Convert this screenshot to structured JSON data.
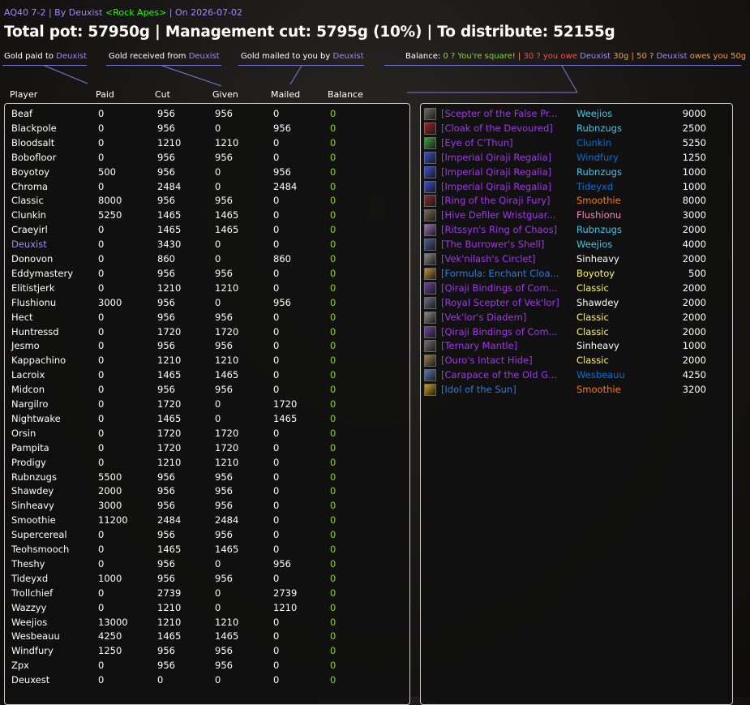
{
  "header": {
    "raid": "AQ40 7-2",
    "by_text": " | By ",
    "author": "Deuxist",
    "guild": "<Rock Apes>",
    "date_text": " | On 2026-07-02",
    "pot_line": "Total pot: 57950g | Management cut: 5795g (10%) | To distribute: 52155g"
  },
  "legend": {
    "paid_label": "Gold paid to ",
    "received_label": "Gold received from ",
    "mailed_label": "Gold mailed to you by ",
    "author": "Deuxist",
    "balance_label": "Balance: ",
    "square_text": "0 ? You're square!",
    "sep": " | ",
    "owe_text": "30 ? you owe ",
    "owe_amount": " 30g",
    "owed_text": "50 ? ",
    "owed_tail": " owes you 50g"
  },
  "columns": [
    "Player",
    "Paid",
    "Cut",
    "Given",
    "Mailed",
    "Balance"
  ],
  "colors": {
    "self_name": "#9a8cff",
    "balance_green": "#8bd52a",
    "epic": "#a335ee",
    "rare": "#2f7bdc",
    "class_mage": "#40c7eb",
    "class_paladin": "#f58cba",
    "class_shaman": "#0070dd",
    "class_priest": "#ffffff",
    "class_druid": "#ff7d0a",
    "class_rogue": "#fff569"
  },
  "players": [
    {
      "name": "Beaf",
      "paid": "0",
      "cut": "956",
      "given": "956",
      "mailed": "0",
      "balance": "0"
    },
    {
      "name": "Blackpole",
      "paid": "0",
      "cut": "956",
      "given": "0",
      "mailed": "956",
      "balance": "0"
    },
    {
      "name": "Bloodsalt",
      "paid": "0",
      "cut": "1210",
      "given": "1210",
      "mailed": "0",
      "balance": "0"
    },
    {
      "name": "Bobofloor",
      "paid": "0",
      "cut": "956",
      "given": "956",
      "mailed": "0",
      "balance": "0"
    },
    {
      "name": "Boyotoy",
      "paid": "500",
      "cut": "956",
      "given": "0",
      "mailed": "956",
      "balance": "0"
    },
    {
      "name": "Chroma",
      "paid": "0",
      "cut": "2484",
      "given": "0",
      "mailed": "2484",
      "balance": "0"
    },
    {
      "name": "Classic",
      "paid": "8000",
      "cut": "956",
      "given": "956",
      "mailed": "0",
      "balance": "0"
    },
    {
      "name": "Clunkin",
      "paid": "5250",
      "cut": "1465",
      "given": "1465",
      "mailed": "0",
      "balance": "0"
    },
    {
      "name": "Craeyirl",
      "paid": "0",
      "cut": "1465",
      "given": "1465",
      "mailed": "0",
      "balance": "0"
    },
    {
      "name": "Deuxist",
      "paid": "0",
      "cut": "3430",
      "given": "0",
      "mailed": "0",
      "balance": "0",
      "self": true
    },
    {
      "name": "Donovon",
      "paid": "0",
      "cut": "860",
      "given": "0",
      "mailed": "860",
      "balance": "0"
    },
    {
      "name": "Eddymastery",
      "paid": "0",
      "cut": "956",
      "given": "956",
      "mailed": "0",
      "balance": "0"
    },
    {
      "name": "Elitistjerk",
      "paid": "0",
      "cut": "1210",
      "given": "1210",
      "mailed": "0",
      "balance": "0"
    },
    {
      "name": "Flushionu",
      "paid": "3000",
      "cut": "956",
      "given": "0",
      "mailed": "956",
      "balance": "0"
    },
    {
      "name": "Hect",
      "paid": "0",
      "cut": "956",
      "given": "956",
      "mailed": "0",
      "balance": "0"
    },
    {
      "name": "Huntressd",
      "paid": "0",
      "cut": "1720",
      "given": "1720",
      "mailed": "0",
      "balance": "0"
    },
    {
      "name": "Jesmo",
      "paid": "0",
      "cut": "956",
      "given": "956",
      "mailed": "0",
      "balance": "0"
    },
    {
      "name": "Kappachino",
      "paid": "0",
      "cut": "1210",
      "given": "1210",
      "mailed": "0",
      "balance": "0"
    },
    {
      "name": "Lacroix",
      "paid": "0",
      "cut": "1465",
      "given": "1465",
      "mailed": "0",
      "balance": "0"
    },
    {
      "name": "Midcon",
      "paid": "0",
      "cut": "956",
      "given": "956",
      "mailed": "0",
      "balance": "0"
    },
    {
      "name": "Nargilro",
      "paid": "0",
      "cut": "1720",
      "given": "0",
      "mailed": "1720",
      "balance": "0"
    },
    {
      "name": "Nightwake",
      "paid": "0",
      "cut": "1465",
      "given": "0",
      "mailed": "1465",
      "balance": "0"
    },
    {
      "name": "Orsin",
      "paid": "0",
      "cut": "1720",
      "given": "1720",
      "mailed": "0",
      "balance": "0"
    },
    {
      "name": "Pampita",
      "paid": "0",
      "cut": "1720",
      "given": "1720",
      "mailed": "0",
      "balance": "0"
    },
    {
      "name": "Prodigy",
      "paid": "0",
      "cut": "1210",
      "given": "1210",
      "mailed": "0",
      "balance": "0"
    },
    {
      "name": "Rubnzugs",
      "paid": "5500",
      "cut": "956",
      "given": "956",
      "mailed": "0",
      "balance": "0"
    },
    {
      "name": "Shawdey",
      "paid": "2000",
      "cut": "956",
      "given": "956",
      "mailed": "0",
      "balance": "0"
    },
    {
      "name": "Sinheavy",
      "paid": "3000",
      "cut": "956",
      "given": "956",
      "mailed": "0",
      "balance": "0"
    },
    {
      "name": "Smoothie",
      "paid": "11200",
      "cut": "2484",
      "given": "2484",
      "mailed": "0",
      "balance": "0"
    },
    {
      "name": "Supercereal",
      "paid": "0",
      "cut": "956",
      "given": "956",
      "mailed": "0",
      "balance": "0"
    },
    {
      "name": "Teohsmooch",
      "paid": "0",
      "cut": "1465",
      "given": "1465",
      "mailed": "0",
      "balance": "0"
    },
    {
      "name": "Theshy",
      "paid": "0",
      "cut": "956",
      "given": "0",
      "mailed": "956",
      "balance": "0"
    },
    {
      "name": "Tideyxd",
      "paid": "1000",
      "cut": "956",
      "given": "956",
      "mailed": "0",
      "balance": "0"
    },
    {
      "name": "Trollchief",
      "paid": "0",
      "cut": "2739",
      "given": "0",
      "mailed": "2739",
      "balance": "0"
    },
    {
      "name": "Wazzyy",
      "paid": "0",
      "cut": "1210",
      "given": "0",
      "mailed": "1210",
      "balance": "0"
    },
    {
      "name": "Weejios",
      "paid": "13000",
      "cut": "1210",
      "given": "1210",
      "mailed": "0",
      "balance": "0"
    },
    {
      "name": "Wesbeauu",
      "paid": "4250",
      "cut": "1465",
      "given": "1465",
      "mailed": "0",
      "balance": "0"
    },
    {
      "name": "Windfury",
      "paid": "1250",
      "cut": "956",
      "given": "956",
      "mailed": "0",
      "balance": "0"
    },
    {
      "name": "Zpx",
      "paid": "0",
      "cut": "956",
      "given": "956",
      "mailed": "0",
      "balance": "0"
    },
    {
      "name": "Deuxest",
      "paid": "0",
      "cut": "0",
      "given": "0",
      "mailed": "0",
      "balance": "0"
    }
  ],
  "items": [
    {
      "name": "[Scepter of the False Pr...",
      "winner": "Weejios",
      "winner_color": "#40c7eb",
      "amount": "9000",
      "quality": "epic",
      "icon": "scepter-icon",
      "icon_color": "#6d6a66"
    },
    {
      "name": "[Cloak of the Devoured]",
      "winner": "Rubnzugs",
      "winner_color": "#40c7eb",
      "amount": "2500",
      "quality": "epic",
      "icon": "cloak-icon",
      "icon_color": "#a02020"
    },
    {
      "name": "[Eye of C'Thun]",
      "winner": "Clunkin",
      "winner_color": "#0070dd",
      "amount": "5250",
      "quality": "epic",
      "icon": "eye-icon",
      "icon_color": "#3aa43a"
    },
    {
      "name": "[Imperial Qiraji Regalia]",
      "winner": "Windfury",
      "winner_color": "#0070dd",
      "amount": "1250",
      "quality": "epic",
      "icon": "regalia-icon",
      "icon_color": "#3a4fd0"
    },
    {
      "name": "[Imperial Qiraji Regalia]",
      "winner": "Rubnzugs",
      "winner_color": "#40c7eb",
      "amount": "1000",
      "quality": "epic",
      "icon": "regalia-icon",
      "icon_color": "#3a4fd0"
    },
    {
      "name": "[Imperial Qiraji Regalia]",
      "winner": "Tideyxd",
      "winner_color": "#0070dd",
      "amount": "1000",
      "quality": "epic",
      "icon": "regalia-icon",
      "icon_color": "#3a4fd0"
    },
    {
      "name": "[Ring of the Qiraji Fury]",
      "winner": "Smoothie",
      "winner_color": "#ff7d0a",
      "amount": "8000",
      "quality": "epic",
      "icon": "ring-icon",
      "icon_color": "#8a2a2a"
    },
    {
      "name": "[Hive Defiler Wristguar...",
      "winner": "Flushionu",
      "winner_color": "#f58cba",
      "amount": "3000",
      "quality": "epic",
      "icon": "wristguard-icon",
      "icon_color": "#7a6a55"
    },
    {
      "name": "[Ritssyn's Ring of Chaos]",
      "winner": "Rubnzugs",
      "winner_color": "#40c7eb",
      "amount": "2000",
      "quality": "epic",
      "icon": "ring-icon",
      "icon_color": "#a070c0"
    },
    {
      "name": "[The Burrower's Shell]",
      "winner": "Weejios",
      "winner_color": "#40c7eb",
      "amount": "4000",
      "quality": "epic",
      "icon": "shell-icon",
      "icon_color": "#4a5aa0"
    },
    {
      "name": "[Vek'nilash's Circlet]",
      "winner": "Sinheavy",
      "winner_color": "#ffffff",
      "amount": "2000",
      "quality": "epic",
      "icon": "circlet-icon",
      "icon_color": "#8a8a8a"
    },
    {
      "name": "[Formula: Enchant Cloa...",
      "winner": "Boyotoy",
      "winner_color": "#fff569",
      "amount": "500",
      "quality": "rare",
      "icon": "formula-icon",
      "icon_color": "#c8903a"
    },
    {
      "name": "[Qiraji Bindings of Com...",
      "winner": "Classic",
      "winner_color": "#fff569",
      "amount": "2000",
      "quality": "epic",
      "icon": "bindings-icon",
      "icon_color": "#7040a0"
    },
    {
      "name": "[Royal Scepter of Vek'lor]",
      "winner": "Shawdey",
      "winner_color": "#ffffff",
      "amount": "2000",
      "quality": "epic",
      "icon": "scepter-icon",
      "icon_color": "#6a6a8a"
    },
    {
      "name": "[Vek'lor's Diadem]",
      "winner": "Classic",
      "winner_color": "#fff569",
      "amount": "2000",
      "quality": "epic",
      "icon": "diadem-icon",
      "icon_color": "#8a8a8a"
    },
    {
      "name": "[Qiraji Bindings of Com...",
      "winner": "Classic",
      "winner_color": "#fff569",
      "amount": "2000",
      "quality": "epic",
      "icon": "bindings-icon",
      "icon_color": "#7040a0"
    },
    {
      "name": "[Ternary Mantle]",
      "winner": "Sinheavy",
      "winner_color": "#ffffff",
      "amount": "1000",
      "quality": "epic",
      "icon": "mantle-icon",
      "icon_color": "#707070"
    },
    {
      "name": "[Ouro's Intact Hide]",
      "winner": "Classic",
      "winner_color": "#fff569",
      "amount": "2000",
      "quality": "epic",
      "icon": "hide-icon",
      "icon_color": "#9a8050"
    },
    {
      "name": "[Carapace of the Old G...",
      "winner": "Wesbeauu",
      "winner_color": "#0070dd",
      "amount": "4250",
      "quality": "epic",
      "icon": "carapace-icon",
      "icon_color": "#5a7ab0"
    },
    {
      "name": "[Idol of the Sun]",
      "winner": "Smoothie",
      "winner_color": "#ff7d0a",
      "amount": "3200",
      "quality": "rare",
      "icon": "idol-icon",
      "icon_color": "#d0a020"
    }
  ]
}
